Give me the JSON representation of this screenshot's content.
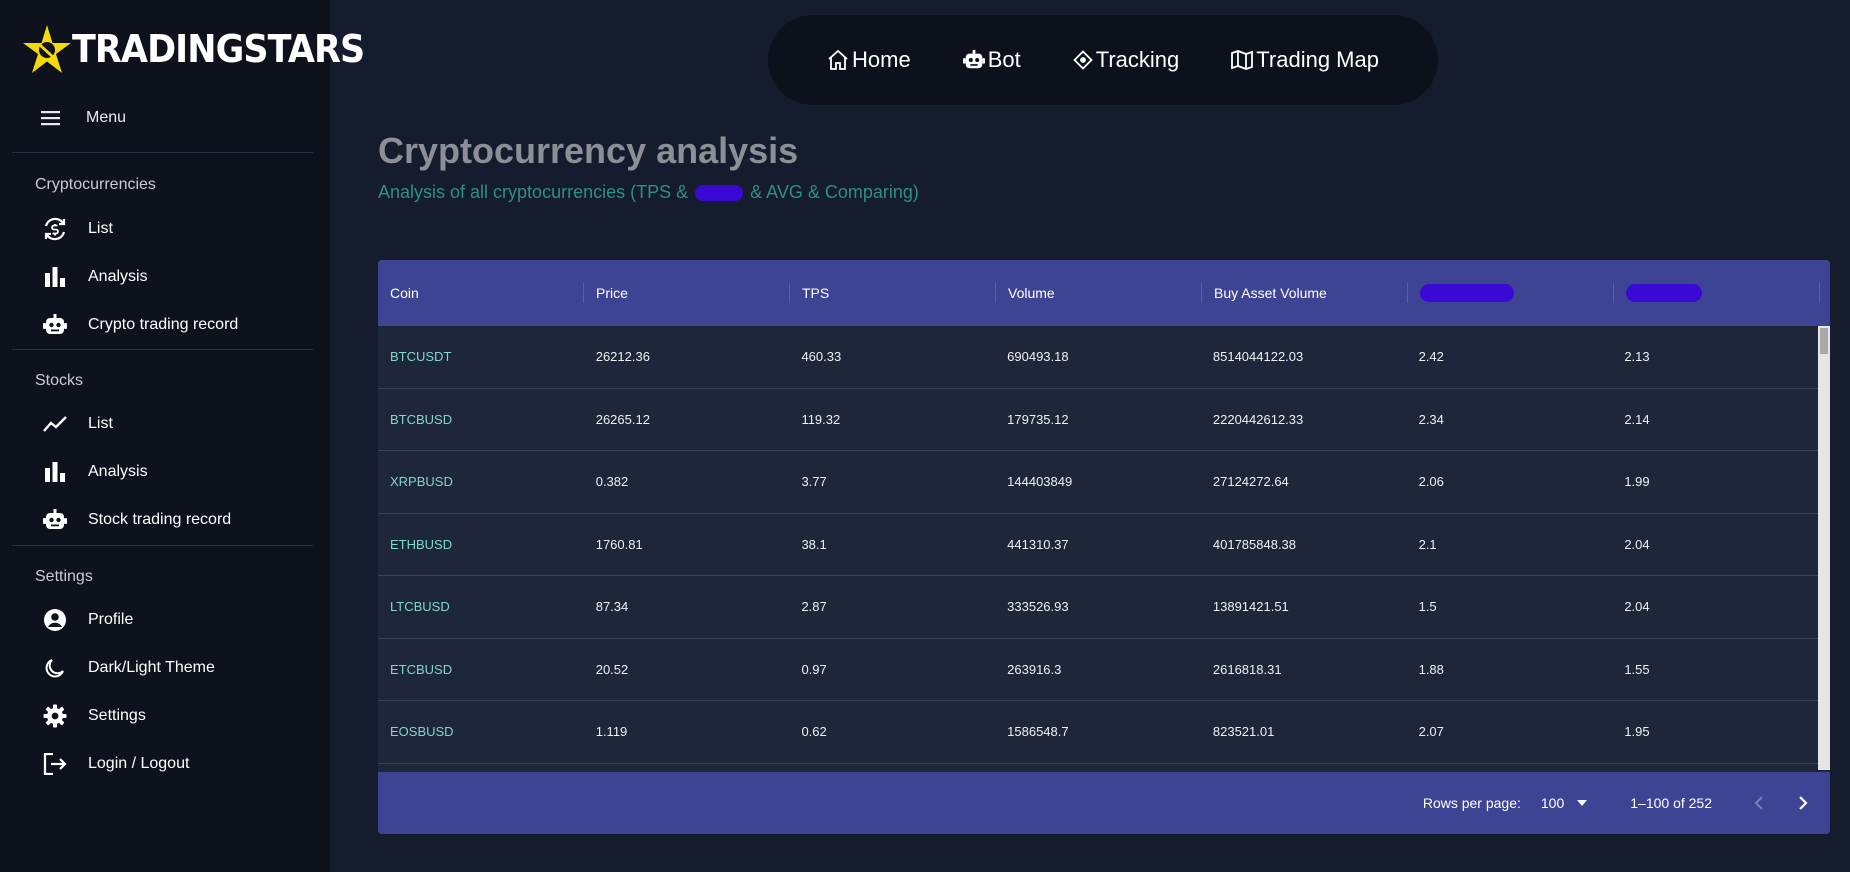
{
  "brand": {
    "name": "TRADINGSTARS"
  },
  "sidebar": {
    "menu_label": "Menu",
    "sections": [
      {
        "title": "Cryptocurrencies",
        "items": [
          {
            "label": "List",
            "icon": "currency-exchange-icon"
          },
          {
            "label": "Analysis",
            "icon": "bar-chart-icon"
          },
          {
            "label": "Crypto trading record",
            "icon": "robot-icon"
          }
        ]
      },
      {
        "title": "Stocks",
        "items": [
          {
            "label": "List",
            "icon": "trending-line-icon"
          },
          {
            "label": "Analysis",
            "icon": "bar-chart-icon"
          },
          {
            "label": "Stock trading record",
            "icon": "robot-icon"
          }
        ]
      },
      {
        "title": "Settings",
        "items": [
          {
            "label": "Profile",
            "icon": "account-circle-icon"
          },
          {
            "label": "Dark/Light Theme",
            "icon": "moon-icon"
          },
          {
            "label": "Settings",
            "icon": "gear-icon"
          },
          {
            "label": "Login / Logout",
            "icon": "logout-icon"
          }
        ]
      }
    ]
  },
  "topnav": {
    "items": [
      {
        "label": "Home",
        "icon": "home-icon"
      },
      {
        "label": "Bot",
        "icon": "robot-icon"
      },
      {
        "label": "Tracking",
        "icon": "target-icon"
      },
      {
        "label": "Trading Map",
        "icon": "map-icon"
      }
    ]
  },
  "page": {
    "title": "Cryptocurrency analysis",
    "subtitle_before": "Analysis of all cryptocurrencies (TPS &",
    "subtitle_after": "& AVG & Comparing)"
  },
  "table": {
    "columns": [
      "Coin",
      "Price",
      "TPS",
      "Volume",
      "Buy Asset Volume",
      "",
      ""
    ],
    "rows": [
      [
        "BTCUSDT",
        "26212.36",
        "460.33",
        "690493.18",
        "8514044122.03",
        "2.42",
        "2.13"
      ],
      [
        "BTCBUSD",
        "26265.12",
        "119.32",
        "179735.12",
        "2220442612.33",
        "2.34",
        "2.14"
      ],
      [
        "XRPBUSD",
        "0.382",
        "3.77",
        "144403849",
        "27124272.64",
        "2.06",
        "1.99"
      ],
      [
        "ETHBUSD",
        "1760.81",
        "38.1",
        "441310.37",
        "401785848.38",
        "2.1",
        "2.04"
      ],
      [
        "LTCBUSD",
        "87.34",
        "2.87",
        "333526.93",
        "13891421.51",
        "1.5",
        "2.04"
      ],
      [
        "ETCBUSD",
        "20.52",
        "0.97",
        "263916.3",
        "2616818.31",
        "1.88",
        "1.55"
      ],
      [
        "EOSBUSD",
        "1.119",
        "0.62",
        "1586548.7",
        "823521.01",
        "2.07",
        "1.95"
      ]
    ],
    "footer": {
      "rows_per_page_label": "Rows per page:",
      "rows_per_page_value": "100",
      "range": "1–100 of 252"
    }
  },
  "colors": {
    "background": "#151c2e",
    "sidebar": "#0d121d",
    "table_header": "#3e4494",
    "accent_teal": "#2f8f82",
    "logo_yellow": "#f5d90a",
    "redaction": "#3b09d6"
  }
}
